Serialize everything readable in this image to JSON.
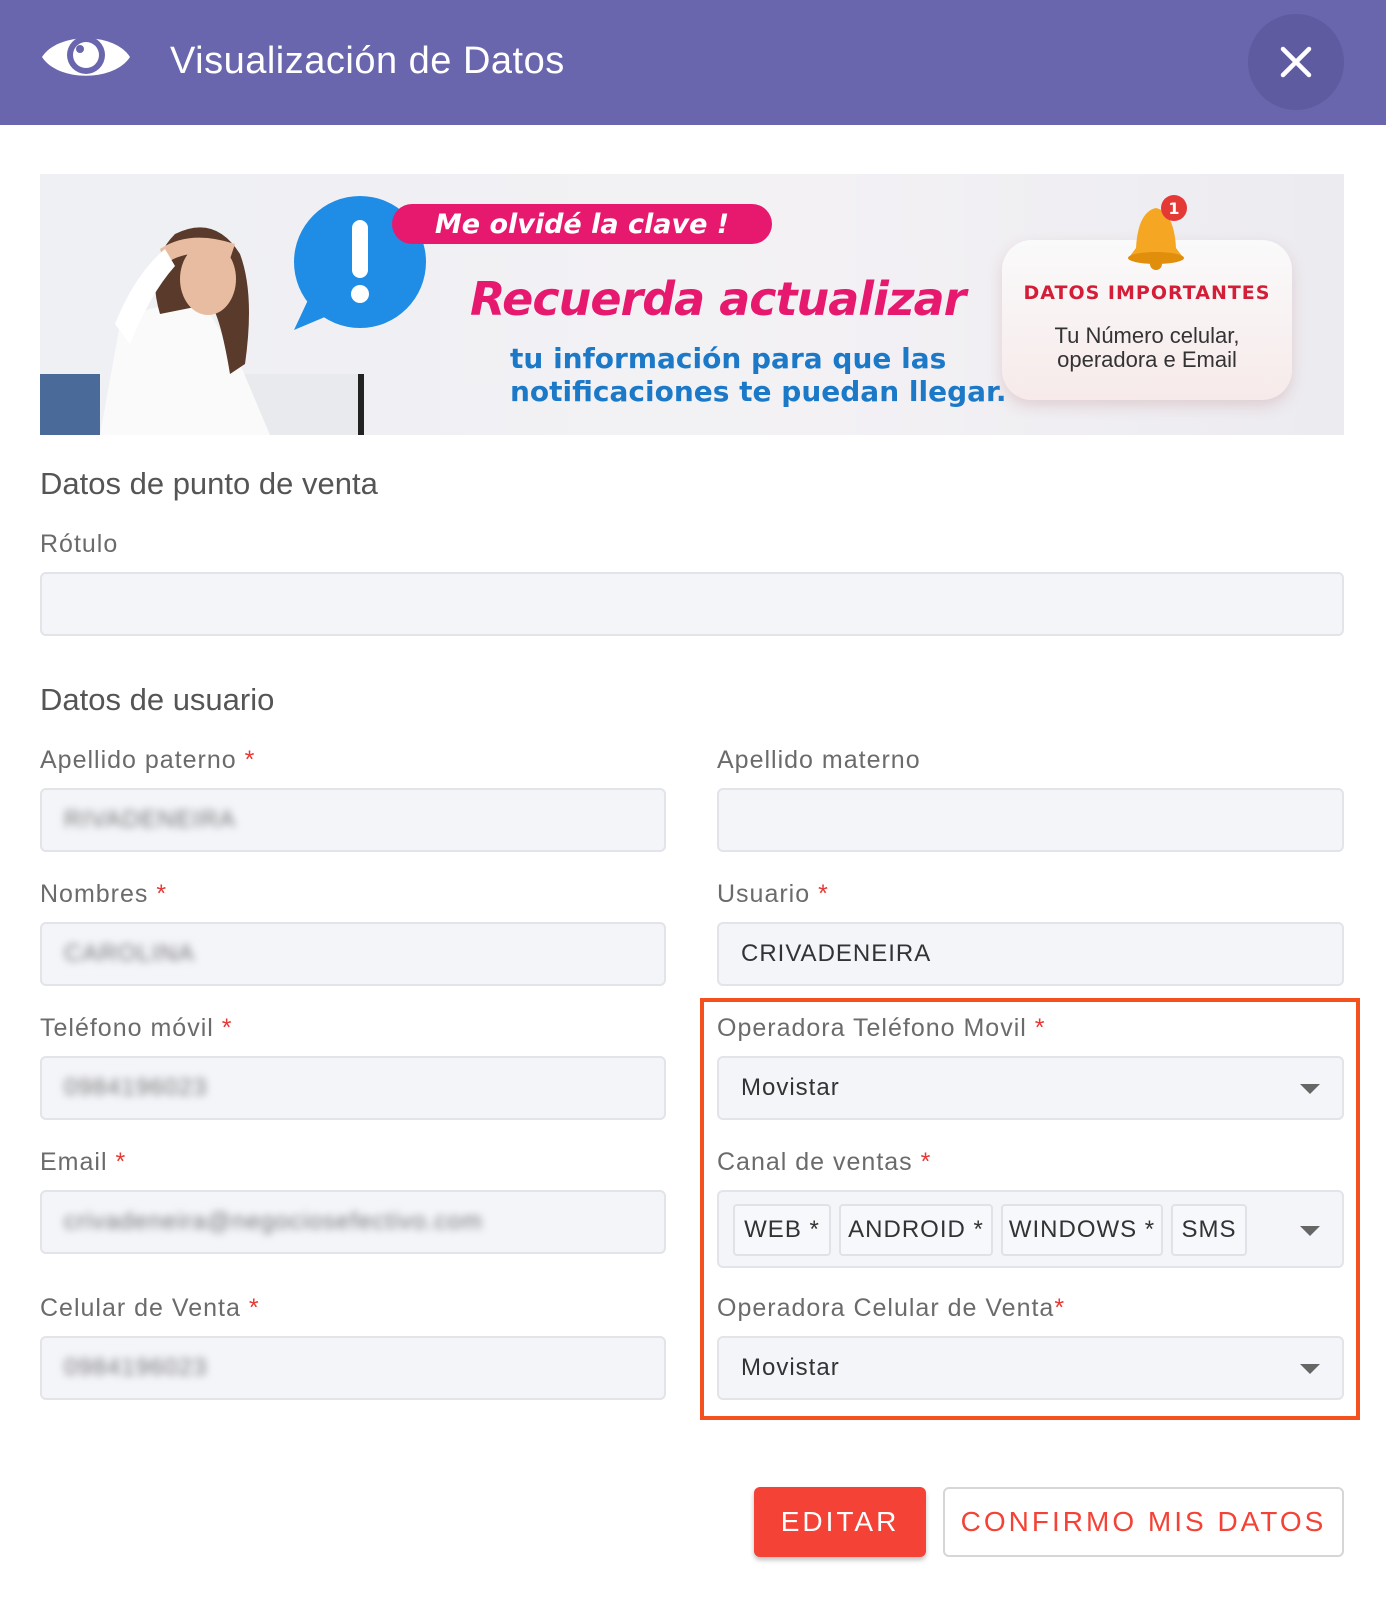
{
  "header": {
    "title": "Visualización de Datos",
    "eye_icon": "eye-icon",
    "close_icon": "close-icon"
  },
  "banner": {
    "pill_text": "Me olvidé la clave !",
    "headline": "Recuerda actualizar",
    "sub_line1": "tu información para que las",
    "sub_line2": "notificaciones te puedan llegar.",
    "card_title": "DATOS IMPORTANTES",
    "card_line1": "Tu Número celular,",
    "card_line2": "operadora e Email",
    "bell_badge": "1"
  },
  "pos_section": {
    "title": "Datos de punto de venta",
    "rotulo_label": "Rótulo",
    "rotulo_value": ""
  },
  "user_section": {
    "title": "Datos de usuario",
    "apellido_paterno_label": "Apellido paterno",
    "apellido_paterno_value": "RIVADENEIRA",
    "apellido_materno_label": "Apellido materno",
    "apellido_materno_value": "",
    "nombres_label": "Nombres",
    "nombres_value": "CAROLINA",
    "usuario_label": "Usuario",
    "usuario_value": "CRIVADENEIRA",
    "telefono_label": "Teléfono móvil",
    "telefono_value": "0984196023",
    "operadora_label": "Operadora Teléfono Movil",
    "operadora_value": "Movistar",
    "email_label": "Email",
    "email_value": "crivadeneira@negociosefectivo.com",
    "canal_label": "Canal de ventas",
    "canal_chips": [
      "WEB *",
      "ANDROID *",
      "WINDOWS *",
      "SMS"
    ],
    "celular_venta_label": "Celular de Venta",
    "celular_venta_value": "0984196023",
    "operadora_venta_label": "Operadora Celular de Venta",
    "operadora_venta_value": "Movistar",
    "required_mark": "*"
  },
  "actions": {
    "edit_label": "EDITAR",
    "confirm_label": "CONFIRMO MIS DATOS"
  },
  "colors": {
    "header_bg": "#6a66ae",
    "accent_red": "#f44336",
    "highlight_orange": "#f4511e",
    "banner_pink": "#e6196f",
    "banner_blue": "#1c79c8"
  }
}
